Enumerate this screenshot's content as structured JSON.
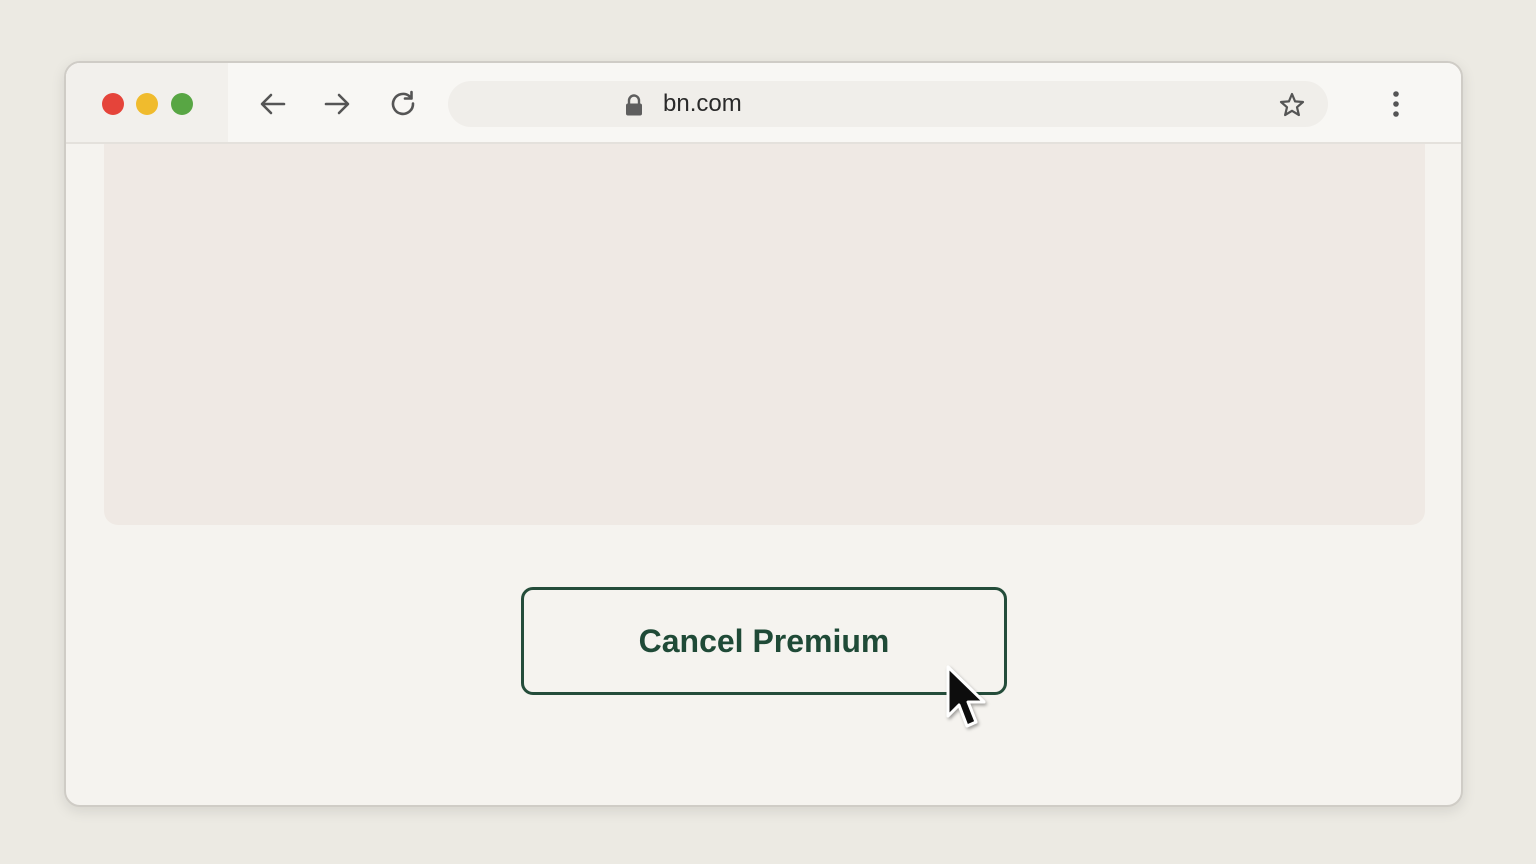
{
  "browser": {
    "url": "bn.com",
    "traffic_lights": {
      "close_color": "#e5443a",
      "minimize_color": "#f0bb2d",
      "maximize_color": "#58a644"
    },
    "icons": {
      "back": "arrow-left-icon",
      "forward": "arrow-right-icon",
      "reload": "reload-icon",
      "lock": "lock-icon",
      "bookmark": "star-icon",
      "menu": "kebab-menu-icon"
    }
  },
  "page": {
    "cancel_button_label": "Cancel Premium",
    "accent_color": "#1f4a37"
  },
  "cursor": {
    "type": "arrow-pointer-icon"
  }
}
